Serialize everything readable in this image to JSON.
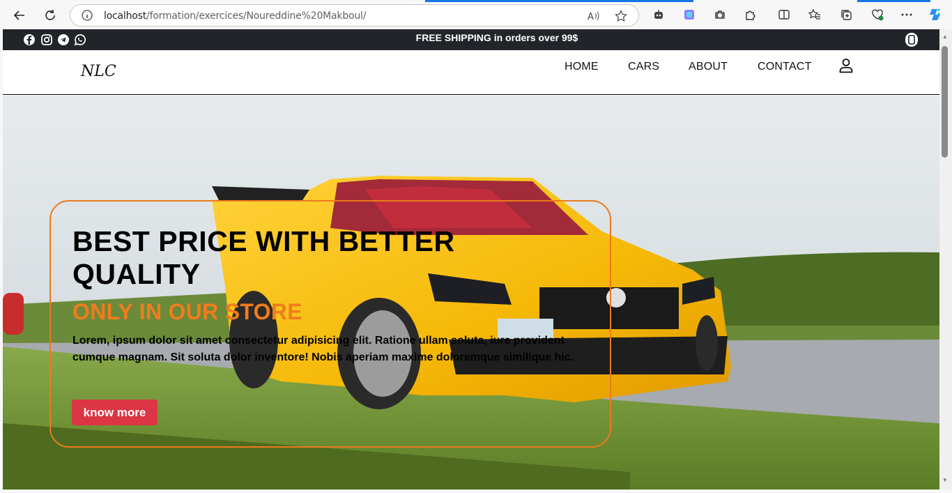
{
  "browser": {
    "url_host": "localhost",
    "url_path": "/formation/exercices/Noureddine%20Makboul/"
  },
  "page": {
    "promo_text": "FREE SHIPPING in orders over 99$",
    "logo": "NLC",
    "nav": [
      "HOME",
      "CARS",
      "ABOUT",
      "CONTACT"
    ],
    "hero": {
      "title_line1": "BEST PRICE WITH BETTER",
      "title_line2": "QUALITY",
      "subtitle": "ONLY IN OUR STORE",
      "description": "Lorem, ipsum dolor sit amet consectetur adipisicing elit. Ratione ullam soluta, iure provident cumque magnam. Sit soluta dolor inventore! Nobis aperiam maxime doloremque similique hic.",
      "button": "know more"
    }
  },
  "colors": {
    "promo_bg": "#212529",
    "accent_orange": "#f07c1c",
    "button_red": "#dc3545"
  },
  "icons": {
    "social": [
      "facebook-icon",
      "instagram-icon",
      "telegram-icon",
      "whatsapp-icon"
    ],
    "header": "user-icon",
    "promo_right": "phone-icon"
  }
}
